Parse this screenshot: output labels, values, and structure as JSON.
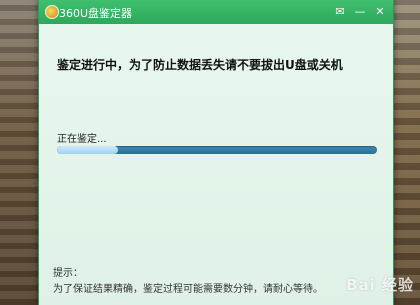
{
  "window": {
    "title": "360U盘鉴定器",
    "message_icon": "✉",
    "minimize_icon": "—",
    "close_icon": "✕"
  },
  "main": {
    "warning": "鉴定进行中，为了防止数据丢失请不要拔出U盘或关机",
    "status": "正在鉴定...",
    "progress": 0.19
  },
  "tip": {
    "label": "提示：",
    "text": "为了保证结果精确，鉴定过程可能需要数分钟，请耐心等待。"
  },
  "watermark": "Bai 经验",
  "colors": {
    "titlebar": "#2ea85a",
    "progress_track": "#2c6f98",
    "progress_fill": "#cfe9f8"
  }
}
